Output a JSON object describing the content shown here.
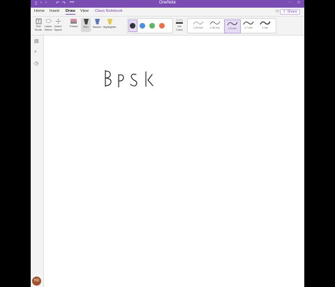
{
  "window": {
    "title": "OneNote"
  },
  "menu": {
    "tabs": [
      "Home",
      "Insert",
      "Draw",
      "View"
    ],
    "active_tab": "Draw",
    "class_notebook": "Class Notebook",
    "share": "Share"
  },
  "ribbon": {
    "tools": [
      {
        "label1": "Text",
        "label2": "Mode"
      },
      {
        "label1": "Lasso",
        "label2": "Select"
      },
      {
        "label1": "Insert",
        "label2": "Space"
      },
      {
        "label1": "Eraser",
        "label2": ""
      },
      {
        "label1": "Pen",
        "label2": ""
      },
      {
        "label1": "Marker",
        "label2": ""
      },
      {
        "label1": "Highlighter",
        "label2": ""
      }
    ],
    "pen_colors": [
      "#333333",
      "#4a90e2",
      "#5cb85c",
      "#e8734a"
    ],
    "ink_color": {
      "label1": "Ink",
      "label2": "Color"
    },
    "thickness": [
      "0.25 mm",
      "0.35 mm",
      "0.5 mm",
      "0.7 mm",
      "1 mm"
    ],
    "selected_thickness": "0.5 mm"
  },
  "user": {
    "initials": "HD"
  },
  "colors": {
    "accent": "#7a4db3"
  }
}
